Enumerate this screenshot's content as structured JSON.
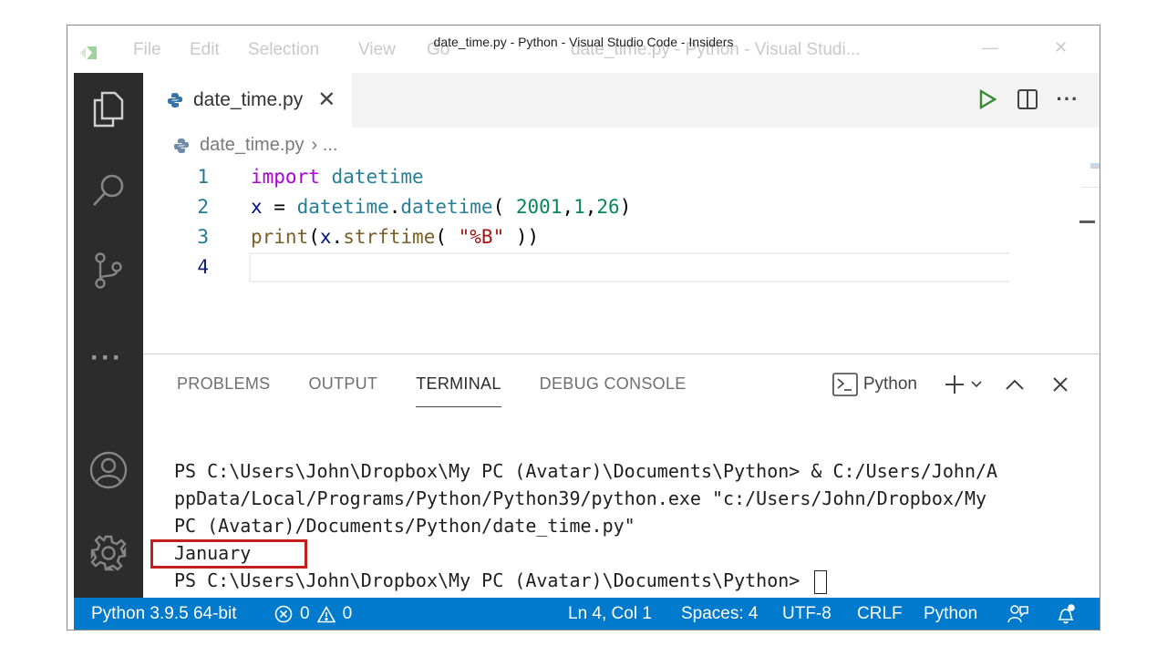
{
  "window": {
    "title": "date_time.py - Python - Visual Studio Code - Insiders",
    "menu_ghost": [
      "File",
      "Edit",
      "Selection",
      "View",
      "Go"
    ],
    "ghost_title": "date_time.py - Python - Visual Studi..."
  },
  "activity_bar": {
    "items": [
      "explorer-icon",
      "search-icon",
      "source-control-icon",
      "more-icon",
      "account-icon",
      "settings-gear-icon"
    ]
  },
  "editor": {
    "tab": {
      "label": "date_time.py",
      "close": "✕"
    },
    "breadcrumb": {
      "file": "date_time.py",
      "rest": "› ..."
    },
    "lines": [
      {
        "n": "1",
        "tokens": [
          [
            "kw",
            "import"
          ],
          [
            "",
            " "
          ],
          [
            "mod",
            "datetime"
          ]
        ]
      },
      {
        "n": "2",
        "tokens": [
          [
            "var",
            "x"
          ],
          [
            "",
            " = "
          ],
          [
            "mod",
            "datetime"
          ],
          [
            "",
            "."
          ],
          [
            "mod",
            "datetime"
          ],
          [
            "",
            "( "
          ],
          [
            "num",
            "2001"
          ],
          [
            "",
            ","
          ],
          [
            "num",
            "1"
          ],
          [
            "",
            ","
          ],
          [
            "num",
            "26"
          ],
          [
            "",
            ")"
          ]
        ]
      },
      {
        "n": "3",
        "tokens": [
          [
            "fn",
            "print"
          ],
          [
            "",
            "("
          ],
          [
            "var",
            "x"
          ],
          [
            "",
            "."
          ],
          [
            "fn",
            "strftime"
          ],
          [
            "",
            "( "
          ],
          [
            "str",
            "\"%B\""
          ],
          [
            "",
            " ))"
          ]
        ]
      },
      {
        "n": "4",
        "tokens": []
      }
    ]
  },
  "panel": {
    "tabs": [
      "PROBLEMS",
      "OUTPUT",
      "TERMINAL",
      "DEBUG CONSOLE"
    ],
    "active_tab": "TERMINAL",
    "terminal_label": "Python"
  },
  "terminal": {
    "lines": [
      "PS C:\\Users\\John\\Dropbox\\My PC (Avatar)\\Documents\\Python> & C:/Users/John/A",
      "ppData/Local/Programs/Python/Python39/python.exe \"c:/Users/John/Dropbox/My",
      "PC (Avatar)/Documents/Python/date_time.py\"",
      "January",
      "PS C:\\Users\\John\\Dropbox\\My PC (Avatar)\\Documents\\Python> "
    ]
  },
  "statusbar": {
    "interpreter": "Python 3.9.5 64-bit",
    "errors": "0",
    "warnings": "0",
    "position": "Ln 4, Col 1",
    "spaces": "Spaces: 4",
    "encoding": "UTF-8",
    "eol": "CRLF",
    "language": "Python"
  },
  "colors": {
    "statusbar": "#007acc",
    "activity_bar": "#2c2c2c",
    "highlight": "#c42020"
  }
}
